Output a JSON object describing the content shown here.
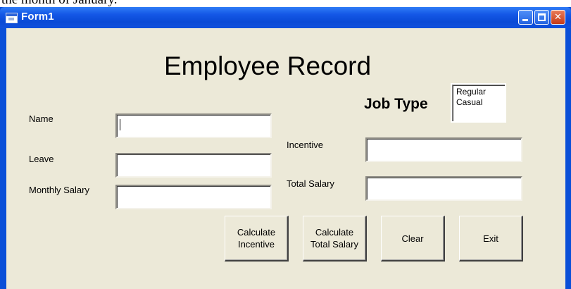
{
  "page_top_text": "the month of January.",
  "window": {
    "title": "Form1",
    "buttons": {
      "minimize": "",
      "maximize": "",
      "close": "✕"
    }
  },
  "form": {
    "heading": "Employee Record",
    "job_type_label": "Job Type",
    "job_type_options": [
      "Regular",
      "Casual"
    ],
    "labels": {
      "name": "Name",
      "leave": "Leave",
      "monthly_salary": "Monthly Salary",
      "incentive": "Incentive",
      "total_salary": "Total Salary"
    },
    "values": {
      "name": "",
      "leave": "",
      "monthly_salary": "",
      "incentive": "",
      "total_salary": ""
    },
    "buttons": {
      "calculate_incentive": "Calculate\nIncentive",
      "calculate_total_salary": "Calculate\nTotal Salary",
      "clear": "Clear",
      "exit": "Exit"
    }
  }
}
